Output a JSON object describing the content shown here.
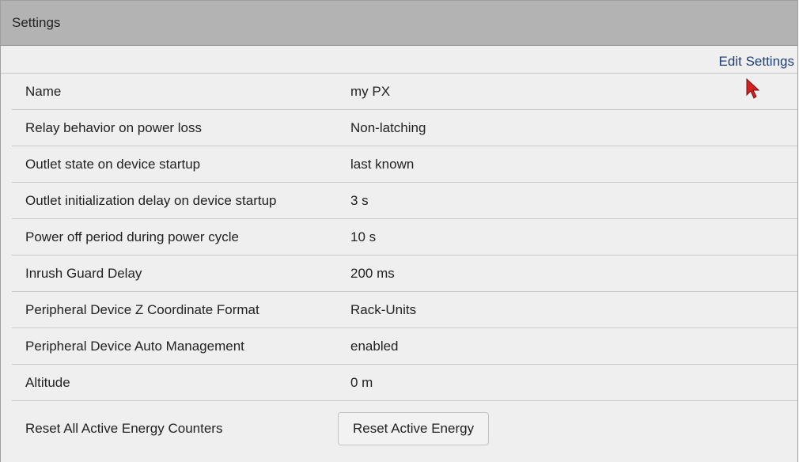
{
  "panel": {
    "title": "Settings",
    "edit_link": "Edit Settings"
  },
  "settings": [
    {
      "label": "Name",
      "value": "my PX"
    },
    {
      "label": "Relay behavior on power loss",
      "value": "Non-latching"
    },
    {
      "label": "Outlet state on device startup",
      "value": "last known"
    },
    {
      "label": "Outlet initialization delay on device startup",
      "value": "3 s"
    },
    {
      "label": "Power off period during power cycle",
      "value": "10 s"
    },
    {
      "label": "Inrush Guard Delay",
      "value": "200 ms"
    },
    {
      "label": "Peripheral Device Z Coordinate Format",
      "value": "Rack-Units"
    },
    {
      "label": "Peripheral Device Auto Management",
      "value": "enabled"
    },
    {
      "label": "Altitude",
      "value": "0 m"
    }
  ],
  "reset": {
    "label": "Reset All Active Energy Counters",
    "button_label": "Reset Active Energy"
  },
  "colors": {
    "header_bg": "#b3b3b3",
    "panel_bg": "#efefef",
    "link": "#1f3f7a",
    "cursor": "#d62020"
  }
}
